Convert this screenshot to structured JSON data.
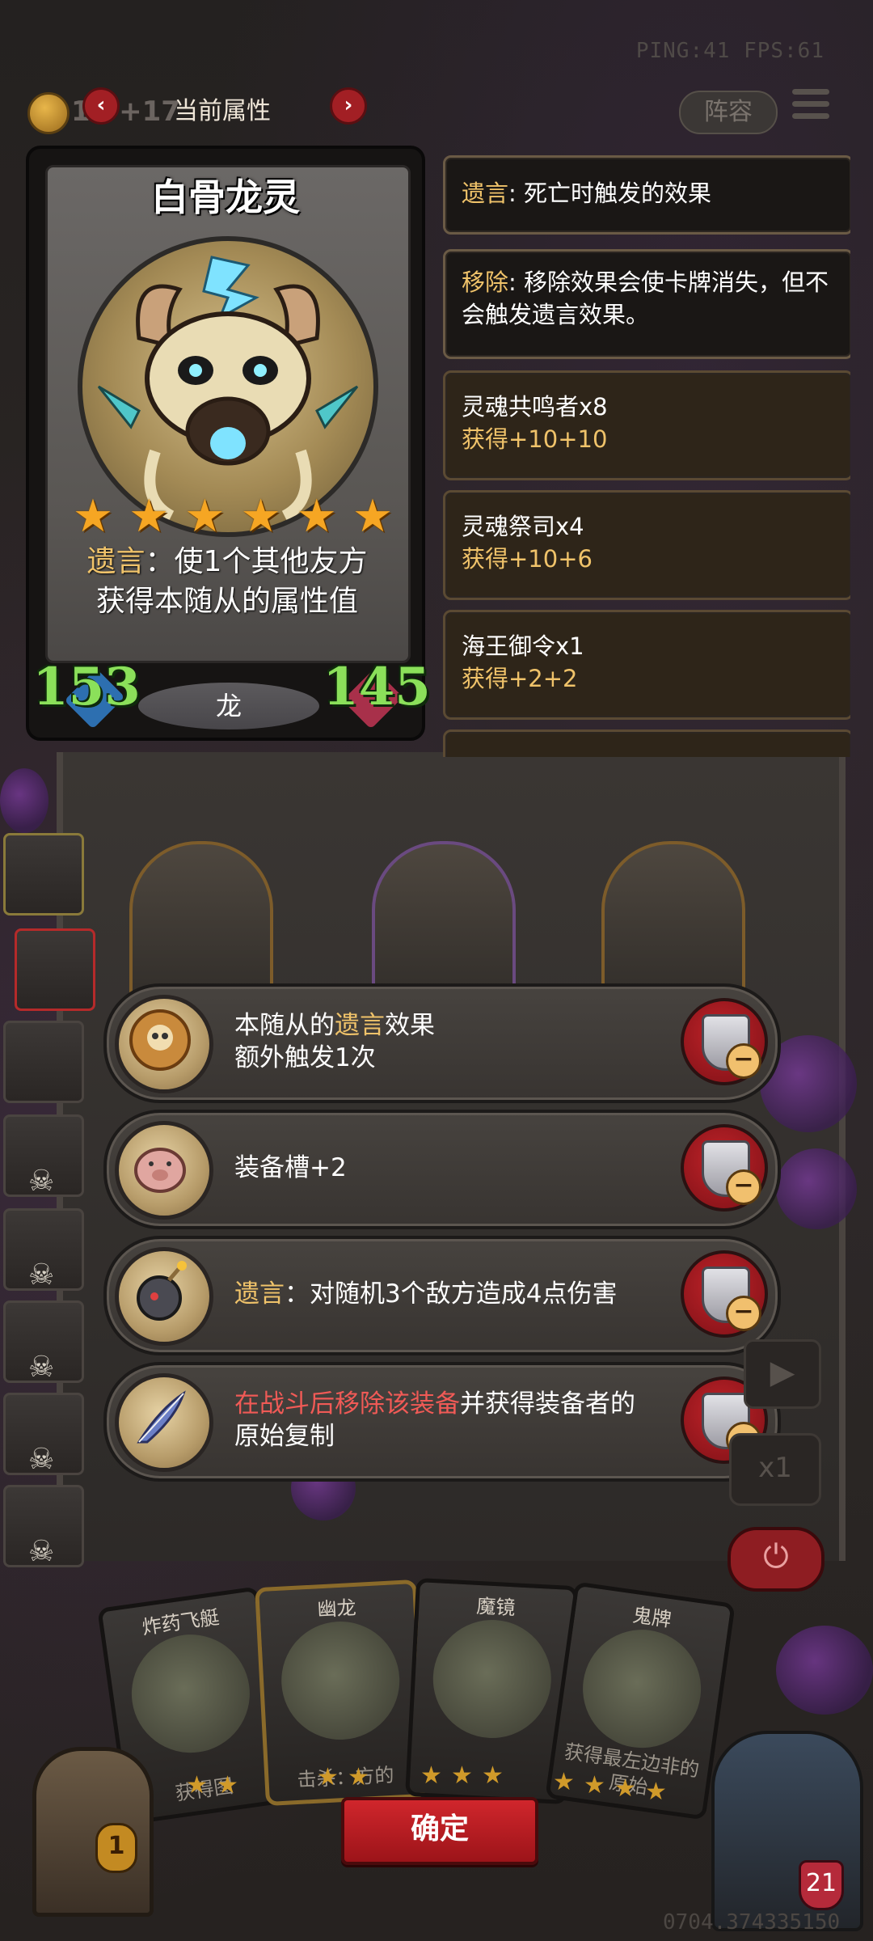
{
  "hud": {
    "ping_fps": "PING:41   FPS:61",
    "coins": "10 +17"
  },
  "header": {
    "title": "当前属性",
    "prev_label": "‹",
    "next_label": "›",
    "lineup_label": "阵容"
  },
  "card": {
    "name": "白骨龙灵",
    "stars": 6,
    "desc_keyword": "遗言",
    "desc_text": "：使1个其他友方获得本随从的属性值",
    "attack": "153",
    "health": "145",
    "tribe": "龙"
  },
  "info_panels": [
    {
      "keyword": "遗言",
      "text": ": 死亡时触发的效果",
      "type": "keyword"
    },
    {
      "keyword": "移除",
      "text": ": 移除效果会使卡牌消失，但不会触发遗言效果。",
      "type": "keyword"
    },
    {
      "title": "灵魂共鸣者x8",
      "sub": "获得+10+10",
      "type": "buff"
    },
    {
      "title": "灵魂祭司x4",
      "sub": "获得+10+6",
      "type": "buff"
    },
    {
      "title": "海王御令x1",
      "sub": "获得+2+2",
      "type": "buff"
    }
  ],
  "equipment": [
    {
      "icon": "skull-coin-icon",
      "pre": "本随从的",
      "keyword": "遗言",
      "post": "效果",
      "line2": "额外触发1次"
    },
    {
      "icon": "pig-icon",
      "pre": "装备槽+2",
      "keyword": "",
      "post": "",
      "line2": ""
    },
    {
      "icon": "bomb-icon",
      "pre": "",
      "keyword": "遗言",
      "post": "：对随机3个敌方造成4点伤害",
      "line2": ""
    },
    {
      "icon": "quill-icon",
      "red": "在战斗后移除该装备",
      "post": "并获得装备者的",
      "line2": "原始复制"
    }
  ],
  "hand_cards": [
    {
      "title": "炸药飞艇",
      "desc": "获得图"
    },
    {
      "title": "幽龙",
      "desc": "击杀：方的"
    },
    {
      "title": "魔镜",
      "desc": ""
    },
    {
      "title": "鬼牌",
      "desc": "获得最左边非的原始"
    }
  ],
  "buttons": {
    "confirm": "确定",
    "speed": "x1",
    "power": "⏻",
    "play": "▶"
  },
  "chest_count": "1",
  "hero_level": "21",
  "bottom_id": "0704.374335150",
  "colors": {
    "keyword_gold": "#f0c36a",
    "keyword_red": "#f05a56",
    "confirm_red": "#c0202a",
    "stat_green": "#8be05a"
  }
}
